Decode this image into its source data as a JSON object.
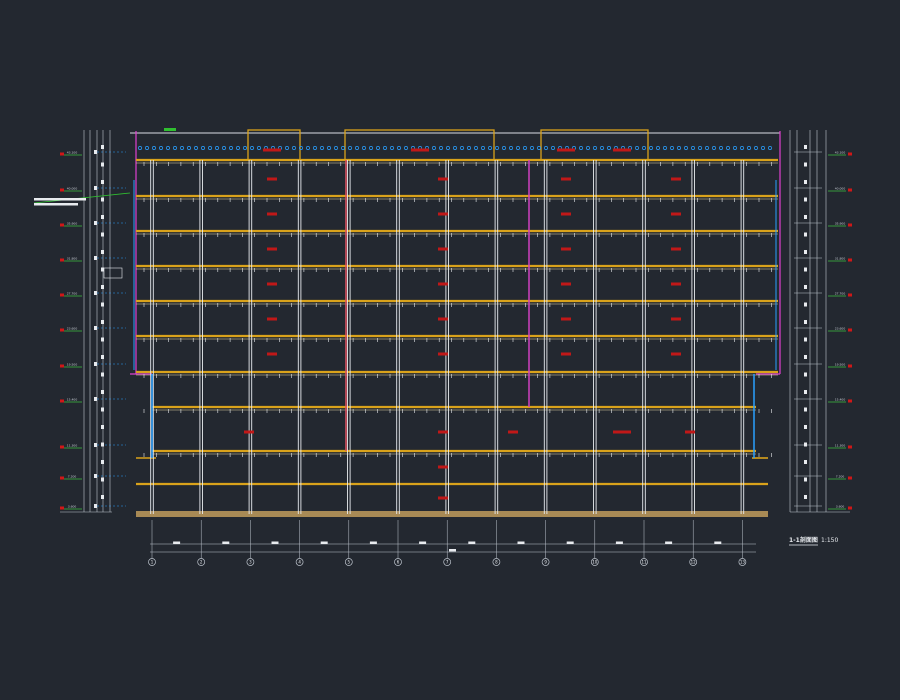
{
  "drawing": {
    "title": "1-1剖面图",
    "scale": "1:150",
    "overall_dim": "8400"
  },
  "colors": {
    "background": "#232830",
    "slab": "#d9a21b",
    "column": "#e8ebef",
    "dim_line": "#bfc6cf",
    "elev_mark": "#d01818",
    "elev_tick": "#3fbf3f",
    "label": "#c01818",
    "parapet": "#e040d0",
    "glazing": "#2aa0ff",
    "ground": "#a88a55",
    "annotation_leader": "#30c030"
  },
  "axis_labels": [
    "1",
    "2",
    "3",
    "4",
    "5",
    "6",
    "7",
    "8",
    "9",
    "10",
    "11",
    "12",
    "13"
  ],
  "bay_dims": [
    "8400",
    "8400",
    "8400",
    "8400",
    "8400",
    "8400",
    "8400",
    "8400",
    "8400",
    "8400",
    "8400",
    "8400"
  ],
  "left_elevations": [
    "43.100",
    "40.000",
    "35.900",
    "31.800",
    "27.700",
    "23.600",
    "19.500",
    "15.400",
    "11.300",
    "7.200",
    "3.600",
    "±0.000"
  ],
  "right_elevations": [
    "43.100",
    "40.000",
    "35.900",
    "31.800",
    "27.700",
    "23.600",
    "19.500",
    "15.400",
    "11.300",
    "7.200",
    "3.600",
    "±0.000"
  ],
  "note_lines": [
    "屋面做法详见建筑构造说明",
    "外墙保温做法详见说明",
    "女儿墙"
  ],
  "room_labels": [
    "机房",
    "机房",
    "机房",
    "机房",
    "办公",
    "办公",
    "办公",
    "办公",
    "办公",
    "办公",
    "办公",
    "办公",
    "办公",
    "办公",
    "办公",
    "办公",
    "办公",
    "办公",
    "办公",
    "办公",
    "办公",
    "办公",
    "办公",
    "办公",
    "办公",
    "办公",
    "办公",
    "办公",
    "大厅",
    "大厅",
    "大厅",
    "大厅",
    "大厅",
    "车库",
    "车库"
  ]
}
